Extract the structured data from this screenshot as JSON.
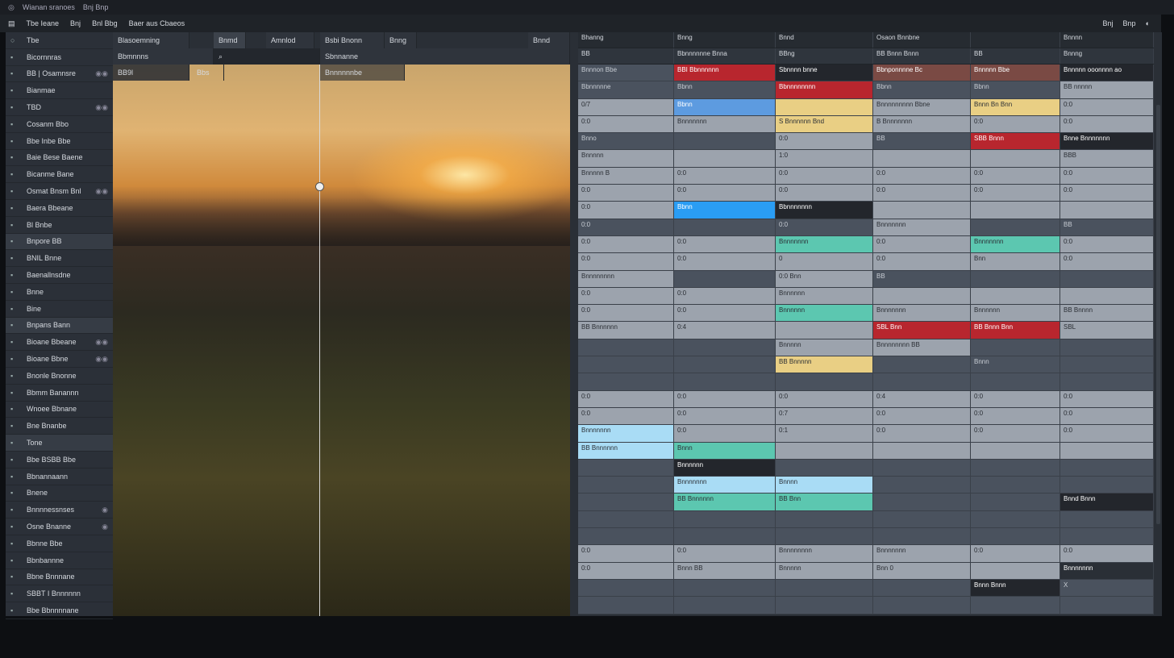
{
  "titlebar": {
    "title": "Wianan sranoes",
    "sub": "Bnj Bnp"
  },
  "menubar": {
    "items": [
      "Tbe Ieane",
      "Bnj",
      "Bnl Bbg",
      "Baer aus Cbaeos"
    ],
    "right": [
      "Bnj",
      "Bnp"
    ]
  },
  "sidebar": {
    "header": "Tbe",
    "items": [
      {
        "label": "Bicornnras"
      },
      {
        "label": "BB | Osamnsre",
        "trail": "◉◉"
      },
      {
        "label": "Bianmae"
      },
      {
        "label": "TBD",
        "trail": "◉◉"
      },
      {
        "label": "Cosanm Bbo"
      },
      {
        "label": "Bbe Inbe Bbe"
      },
      {
        "label": "Baie Bese Baene"
      },
      {
        "label": "Bicanme Bane"
      },
      {
        "label": "Osmat Bnsm Bnl",
        "trail": "◉◉"
      },
      {
        "label": "Baera Bbeane"
      },
      {
        "label": "Bl Bnbe"
      },
      {
        "label": "Bnpore BB",
        "sel": true
      },
      {
        "label": "BNIL Bnne"
      },
      {
        "label": "Baenallnsdne"
      },
      {
        "label": "Bnne"
      },
      {
        "label": "Bine"
      },
      {
        "label": "Bnpans Bann",
        "sel": true
      },
      {
        "label": "Bioane Bbeane",
        "trail": "◉◉"
      },
      {
        "label": "Bioane Bbne",
        "trail": "◉◉"
      },
      {
        "label": "Bnonle Bnonne"
      },
      {
        "label": "Bbmm Banannn"
      },
      {
        "label": "Wnoee Bbnane"
      },
      {
        "label": "Bne Bnanbe"
      },
      {
        "label": "Tone",
        "sel": true
      },
      {
        "label": "Bbe BSBB Bbe"
      },
      {
        "label": "Bbnannaann"
      },
      {
        "label": "Bnene"
      },
      {
        "label": "Bnnnnessnses",
        "trail": "◉"
      },
      {
        "label": "Osne Bnanne",
        "trail": "◉"
      },
      {
        "label": "Bbnne Bbe"
      },
      {
        "label": "Bbnbannne"
      },
      {
        "label": "Bbne Bnnnane"
      },
      {
        "label": "SBBT I Bnnnnnn"
      },
      {
        "label": "Bbe Bbnnnnane"
      }
    ]
  },
  "photo_panel": {
    "tabs": [
      "Blasoemning",
      "Bnmd",
      "Amnlod",
      "Bsbi Bnonn",
      "Bnng",
      "Bnnd"
    ],
    "sub": [
      "Bbmnnns",
      "Sbnnanne",
      "BB9l",
      "Bbs",
      "Bnnnnnnbe"
    ]
  },
  "grid": {
    "headers": [
      "Bhanng",
      "Bnng",
      "Bnnd",
      "Osaon Bnnbne",
      "",
      "Bnnnn"
    ],
    "subheaders": [
      "BB",
      "Bbnnnnnne Bnna",
      "BBng",
      "BB Bnnn Bnnn",
      "BB",
      "Bnnng"
    ],
    "rows": [
      {
        "tone": "dark",
        "cells": [
          "Bnnnon Bbe",
          "BBI Bbnnnnnn",
          "Sbnnnn bnne",
          "Bbnponnnne Bc",
          "Bnnnnn Bbe",
          "Bnnnnn ooonnnn ao"
        ],
        "hl": {
          "1": "#b8262e",
          "2": "#23262c",
          "3": "#7a4a44",
          "4": "#7a4a44",
          "5": "#23262c"
        }
      },
      {
        "tone": "dark",
        "cells": [
          "Bbnnnnne",
          "Bbnn",
          "Bbnnnnnnnn",
          "Bbnn",
          "Bbnn",
          "BB nnnnn"
        ],
        "hl": {
          "2": "#b8262e",
          "5": "#9ca3ad"
        }
      },
      {
        "tone": "light",
        "cells": [
          "0/7",
          "Bbnn",
          "",
          "Bnnnnnnnnn Bbne",
          "Bnnn Bn Bnn",
          "0:0"
        ],
        "hl": {
          "1": "#5d9be0",
          "2": "#e9cf84",
          "4": "#e9cf84"
        }
      },
      {
        "tone": "light",
        "cells": [
          "0:0",
          "Bnnnnnnn",
          "S Bnnnnnn Bnd",
          "B Bnnnnnnn",
          "0:0",
          "0:0"
        ],
        "hl": {
          "2": "#e9cf84"
        }
      },
      {
        "tone": "dark",
        "cells": [
          "Bnno",
          "",
          "0:0",
          "BB",
          "SBB Bnnn",
          "Bnne Bnnnnnnn"
        ],
        "hl": {
          "2": "#9ca3ad",
          "4": "#b8262e",
          "5": "#23262c"
        }
      },
      {
        "tone": "light",
        "cells": [
          "Bnnnnn",
          "",
          "1:0",
          "",
          "",
          "BBB"
        ],
        "hl": {}
      },
      {
        "tone": "light",
        "cells": [
          "Bnnnnn B",
          "0:0",
          "0:0",
          "0:0",
          "0:0",
          "0:0"
        ],
        "hl": {}
      },
      {
        "tone": "light",
        "cells": [
          "0:0",
          "0:0",
          "0:0",
          "0:0",
          "0:0",
          "0:0"
        ],
        "hl": {}
      },
      {
        "tone": "light",
        "cells": [
          "0:0",
          "Bbnn",
          "Bbnnnnnnn",
          "",
          "",
          ""
        ],
        "hl": {
          "1": "#2a9df4",
          "2": "#23262c"
        }
      },
      {
        "tone": "dark",
        "cells": [
          "0:0",
          "",
          "0:0",
          "Bnnnnnnn",
          "",
          "BB"
        ],
        "hl": {
          "3": "#9ca3ad"
        }
      },
      {
        "tone": "light",
        "cells": [
          "0:0",
          "0:0",
          "Bnnnnnnn",
          "0:0",
          "Bnnnnnnn",
          "0:0"
        ],
        "hl": {
          "2": "#5cc7b0",
          "4": "#5cc7b0"
        }
      },
      {
        "tone": "light",
        "cells": [
          "0:0",
          "0:0",
          "0",
          "0:0",
          "Bnn",
          "0:0"
        ],
        "hl": {}
      },
      {
        "tone": "dark",
        "cells": [
          "Bnnnnnnnn",
          "",
          "0:0 Bnn",
          "BB",
          "",
          ""
        ],
        "hl": {
          "0": "#9ca3ad",
          "2": "#9ca3ad"
        }
      },
      {
        "tone": "light",
        "cells": [
          "0:0",
          "0:0",
          "Bnnnnnn",
          "",
          "",
          ""
        ],
        "hl": {}
      },
      {
        "tone": "light",
        "cells": [
          "0:0",
          "0:0",
          "Bnnnnnn",
          "Bnnnnnnn",
          "Bnnnnnn",
          "BB Bnnnn"
        ],
        "hl": {
          "2": "#5cc7b0"
        }
      },
      {
        "tone": "light",
        "cells": [
          "BB Bnnnnnn",
          "0:4",
          "",
          "SBL Bnn",
          "BB Bnnn Bnn",
          "SBL"
        ],
        "hl": {
          "3": "#b8262e",
          "4": "#b8262e"
        }
      },
      {
        "tone": "dark",
        "cells": [
          "",
          "",
          "Bnnnnn",
          "Bnnnnnnnn BB",
          "",
          ""
        ],
        "hl": {
          "2": "#9ca3ad",
          "3": "#9ca3ad"
        }
      },
      {
        "tone": "dark",
        "cells": [
          "",
          "",
          "BB Bnnnnn",
          "",
          "Bnnn",
          ""
        ],
        "hl": {
          "2": "#e9cf84"
        }
      },
      {
        "tone": "dark",
        "cells": [
          "",
          "",
          "",
          "",
          "",
          ""
        ],
        "hl": {}
      },
      {
        "tone": "light",
        "cells": [
          "0:0",
          "0:0",
          "0:0",
          "0:4",
          "0:0",
          "0:0"
        ],
        "hl": {}
      },
      {
        "tone": "light",
        "cells": [
          "0:0",
          "0:0",
          "0:7",
          "0:0",
          "0:0",
          "0:0"
        ],
        "hl": {}
      },
      {
        "tone": "light",
        "cells": [
          "Bnnnnnnn",
          "0:0",
          "0:1",
          "0:0",
          "0:0",
          "0:0"
        ],
        "hl": {
          "0": "#a9dcf5"
        }
      },
      {
        "tone": "light",
        "cells": [
          "BB Bnnnnnn",
          "Bnnn",
          "",
          "",
          "",
          ""
        ],
        "hl": {
          "0": "#a9dcf5",
          "1": "#5cc7b0"
        }
      },
      {
        "tone": "dark",
        "cells": [
          "",
          "Bnnnnnn",
          "",
          "",
          "",
          ""
        ],
        "hl": {
          "1": "#23262c"
        }
      },
      {
        "tone": "dark",
        "cells": [
          "",
          "Bnnnnnnn",
          "Bnnnn",
          "",
          "",
          ""
        ],
        "hl": {
          "1": "#a9dcf5",
          "2": "#a9dcf5"
        }
      },
      {
        "tone": "dark",
        "cells": [
          "",
          "BB Bnnnnnn",
          "BB Bnn",
          "",
          "",
          "Bnnd Bnnn"
        ],
        "hl": {
          "1": "#5cc7b0",
          "2": "#5cc7b0",
          "5": "#23262c"
        }
      },
      {
        "tone": "dark",
        "cells": [
          "",
          "",
          "",
          "",
          "",
          ""
        ],
        "hl": {}
      },
      {
        "tone": "dark",
        "cells": [
          "",
          "",
          "",
          "",
          "",
          ""
        ],
        "hl": {}
      },
      {
        "tone": "light",
        "cells": [
          "0:0",
          "0:0",
          "Bnnnnnnnn",
          "Bnnnnnnn",
          "0:0",
          "0:0"
        ],
        "hl": {}
      },
      {
        "tone": "light",
        "cells": [
          "0:0",
          "Bnnn BB",
          "Bnnnnn",
          "Bnn 0",
          "",
          "Bnnnnnnn"
        ],
        "hl": {
          "5": "#2a2f36"
        }
      },
      {
        "tone": "dark",
        "cells": [
          "",
          "",
          "",
          "",
          "Bnnn Bnnn",
          "X"
        ],
        "hl": {
          "4": "#23262c"
        }
      },
      {
        "tone": "dark",
        "cells": [
          "",
          "",
          "",
          "",
          "",
          ""
        ],
        "hl": {}
      }
    ]
  }
}
